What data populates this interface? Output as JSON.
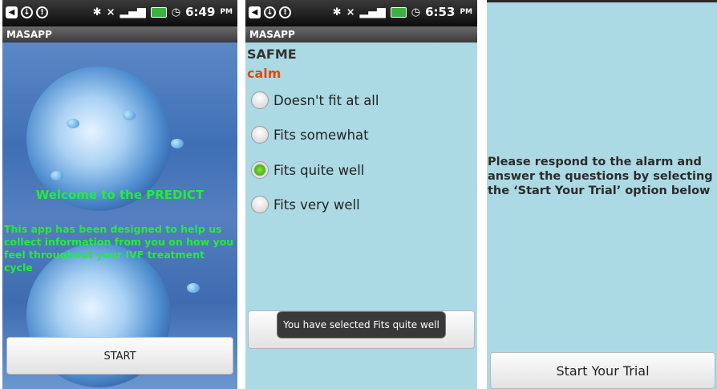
{
  "screens": [
    {
      "status": {
        "time": "6:49",
        "ampm": "PM"
      },
      "app_title": "MASAPP",
      "welcome": "Welcome to the PREDICT",
      "intro": "This app has been designed to help us collect information from you on how you feel throughout your IVF treatment cycle",
      "start_button": "START"
    },
    {
      "status": {
        "time": "6:53",
        "ampm": "PM"
      },
      "app_title": "MASAPP",
      "scale": "SAFME",
      "word": "calm",
      "options": [
        "Doesn't fit at all",
        "Fits somewhat",
        "Fits quite well",
        "Fits very well"
      ],
      "selected_index": 2,
      "toast": "You have selected Fits quite well"
    },
    {
      "message": "Please respond to the alarm and answer the questions by selecting the ‘Start Your Trial’ option below",
      "trial_button": "Start Your Trial"
    }
  ],
  "colors": {
    "accent_green": "#22ee33",
    "word_orange": "#e24a0d",
    "background_blue": "#acdae4"
  },
  "icons": [
    "back-icon",
    "download-icon",
    "alert-icon",
    "bluetooth-icon",
    "silent-icon",
    "signal-icon",
    "battery-icon",
    "alarm-icon"
  ]
}
